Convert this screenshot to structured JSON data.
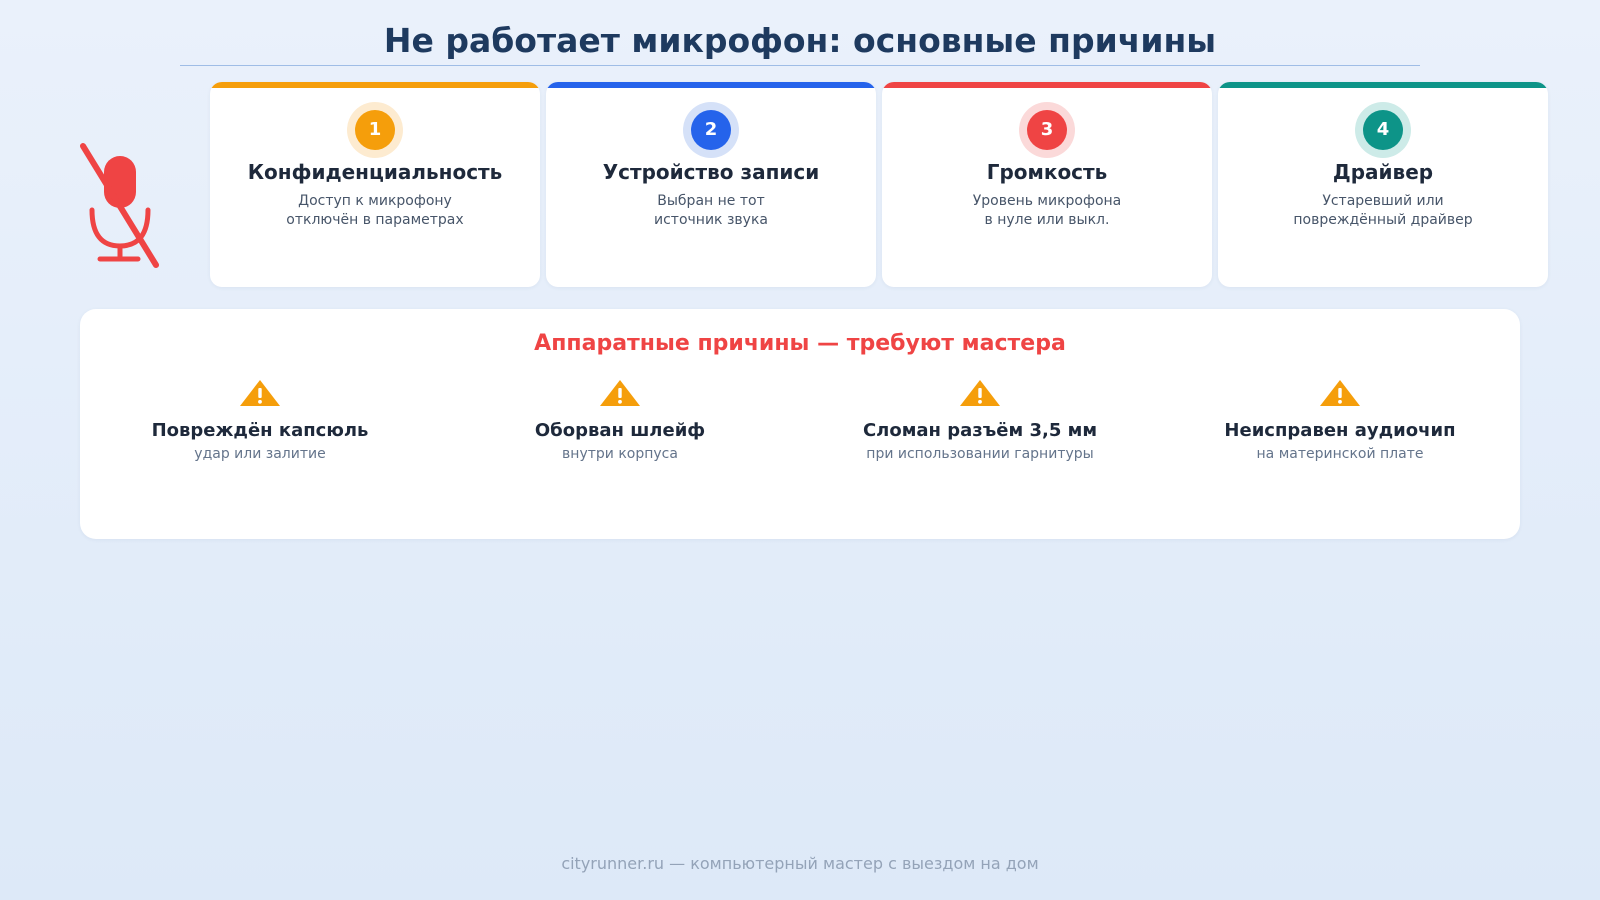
{
  "title": "Не работает микрофон: основные причины",
  "icons": {
    "hero": "microphone-muted-icon",
    "warning": "warning-triangle-icon",
    "hero_color": "#ef4444",
    "warning_color": "#f59e0b"
  },
  "software_causes": [
    {
      "number": "1",
      "title": "Конфиденциальность",
      "desc_lines": [
        "Доступ к микрофону",
        "отключён в параметрах"
      ],
      "color": "#f59e0b",
      "light_color": "#fdebd0"
    },
    {
      "number": "2",
      "title": "Устройство записи",
      "desc_lines": [
        "Выбран не тот",
        "источник звука"
      ],
      "color": "#2563eb",
      "light_color": "#d5e1f8"
    },
    {
      "number": "3",
      "title": "Громкость",
      "desc_lines": [
        "Уровень микрофона",
        "в нуле или выкл."
      ],
      "color": "#ef4444",
      "light_color": "#fbd9d9"
    },
    {
      "number": "4",
      "title": "Драйвер",
      "desc_lines": [
        "Устаревший или",
        "повреждённый драйвер"
      ],
      "color": "#0d9488",
      "light_color": "#cdebe8"
    }
  ],
  "hardware": {
    "title": "Аппаратные причины — требуют мастера",
    "items": [
      {
        "title": "Повреждён капсюль",
        "subtitle": "удар или залитие"
      },
      {
        "title": "Оборван шлейф",
        "subtitle": "внутри корпуса"
      },
      {
        "title": "Сломан разъём 3,5 мм",
        "subtitle": "при использовании гарнитуры"
      },
      {
        "title": "Неисправен аудиочип",
        "subtitle": "на материнской плате"
      }
    ]
  },
  "footer": "cityrunner.ru — компьютерный мастер с выездом на дом"
}
